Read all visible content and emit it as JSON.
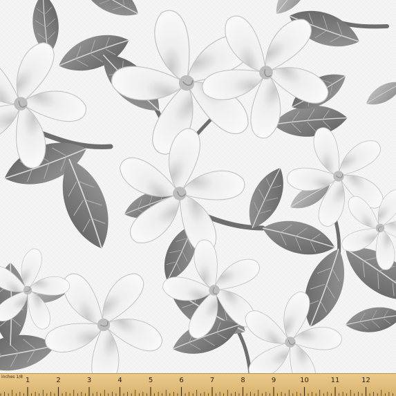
{
  "image": {
    "subject": "grayscale floral fabric swatch",
    "colors": {
      "background": "#f4f4f4",
      "leaf_dark": "#6b6b6b",
      "leaf_mid": "#8e8e8e",
      "leaf_light": "#b5b5b5",
      "petal": "#ececec",
      "petal_shade": "#cfcfcf",
      "stem": "#6a6a6a",
      "ruler": "#e2bf7c"
    }
  },
  "ruler": {
    "unit_label": "inches 1/8",
    "numbers": [
      "1",
      "2",
      "3",
      "4",
      "5",
      "6",
      "7",
      "8",
      "9",
      "10",
      "11",
      "12",
      "1"
    ]
  }
}
